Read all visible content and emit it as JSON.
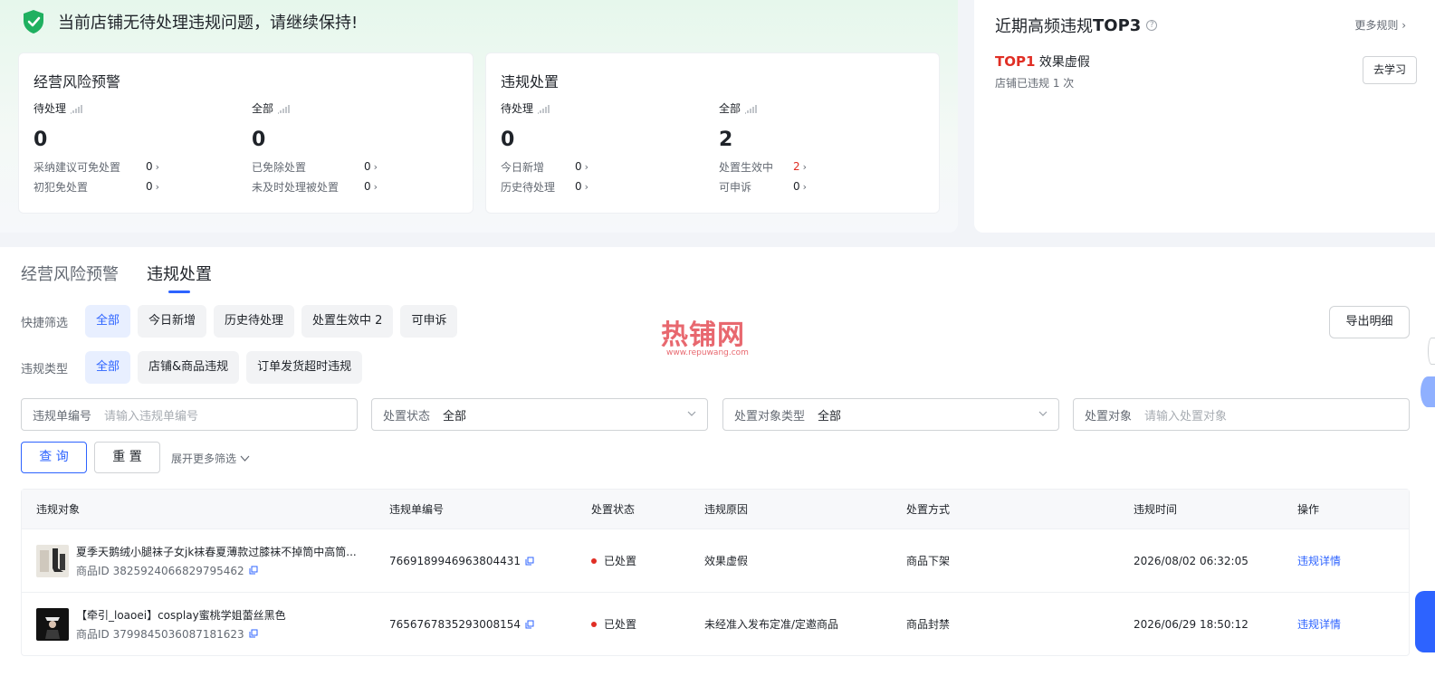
{
  "banner": {
    "text": "当前店铺无待处理违规问题，请继续保持!"
  },
  "risk_card": {
    "title": "经营风险预警",
    "pending": {
      "label": "待处理",
      "value": "0",
      "rows": [
        {
          "label": "采纳建议可免处置",
          "value": "0"
        },
        {
          "label": "初犯免处置",
          "value": "0"
        }
      ]
    },
    "all": {
      "label": "全部",
      "value": "0",
      "rows": [
        {
          "label": "已免除处置",
          "value": "0"
        },
        {
          "label": "未及时处理被处置",
          "value": "0"
        }
      ]
    }
  },
  "violation_card": {
    "title": "违规处置",
    "pending": {
      "label": "待处理",
      "value": "0",
      "rows": [
        {
          "label": "今日新增",
          "value": "0"
        },
        {
          "label": "历史待处理",
          "value": "0"
        }
      ]
    },
    "all": {
      "label": "全部",
      "value": "2",
      "rows": [
        {
          "label": "处置生效中",
          "value": "2"
        },
        {
          "label": "可申诉",
          "value": "0"
        }
      ]
    }
  },
  "top3": {
    "title_prefix": "近期高频违规",
    "title_bold": "TOP3",
    "help_icon": "question-circle-icon",
    "more_label": "更多规则",
    "item_rank": "TOP1",
    "item_name": "效果虚假",
    "item_sub": "店铺已违规 1 次",
    "learn_label": "去学习"
  },
  "tabs": [
    {
      "label": "经营风险预警"
    },
    {
      "label": "违规处置"
    }
  ],
  "quick_filter": {
    "label": "快捷筛选",
    "chips": [
      "全部",
      "今日新增",
      "历史待处理",
      "处置生效中 2",
      "可申诉"
    ]
  },
  "type_filter": {
    "label": "违规类型",
    "chips": [
      "全部",
      "店铺&商品违规",
      "订单发货超时违规"
    ]
  },
  "export_label": "导出明细",
  "watermark": {
    "main": "热铺网",
    "sub": "www.repuwang.com"
  },
  "fields": {
    "order_no": {
      "label": "违规单编号",
      "placeholder": "请输入违规单编号"
    },
    "status": {
      "label": "处置状态",
      "value": "全部"
    },
    "object_type": {
      "label": "处置对象类型",
      "value": "全部"
    },
    "object": {
      "label": "处置对象",
      "placeholder": "请输入处置对象"
    }
  },
  "buttons": {
    "query": "查 询",
    "reset": "重 置",
    "more_filter": "展开更多筛选"
  },
  "table": {
    "headers": [
      "违规对象",
      "违规单编号",
      "处置状态",
      "违规原因",
      "处置方式",
      "违规时间",
      "操作"
    ],
    "rows": [
      {
        "name": "夏季天鹅绒小腿袜子女jk袜春夏薄款过膝袜不掉筒中高筒...",
        "pid": "商品ID 3825924066829795462",
        "order_no": "7669189946963804431",
        "status": "已处置",
        "reason": "效果虚假",
        "method": "商品下架",
        "time": "2026/08/02 06:32:05",
        "action": "违规详情"
      },
      {
        "name": "【牵引_loaoei】cosplay蜜桃学姐蕾丝黑色",
        "pid": "商品ID 3799845036087181623",
        "order_no": "7656767835293008154",
        "status": "已处置",
        "reason": "未经准入发布定准/定邀商品",
        "method": "商品封禁",
        "time": "2026/06/29 18:50:12",
        "action": "违规详情"
      }
    ]
  },
  "colors": {
    "accent": "#2d63ff",
    "danger": "#e02e24",
    "success": "#1fb060"
  }
}
